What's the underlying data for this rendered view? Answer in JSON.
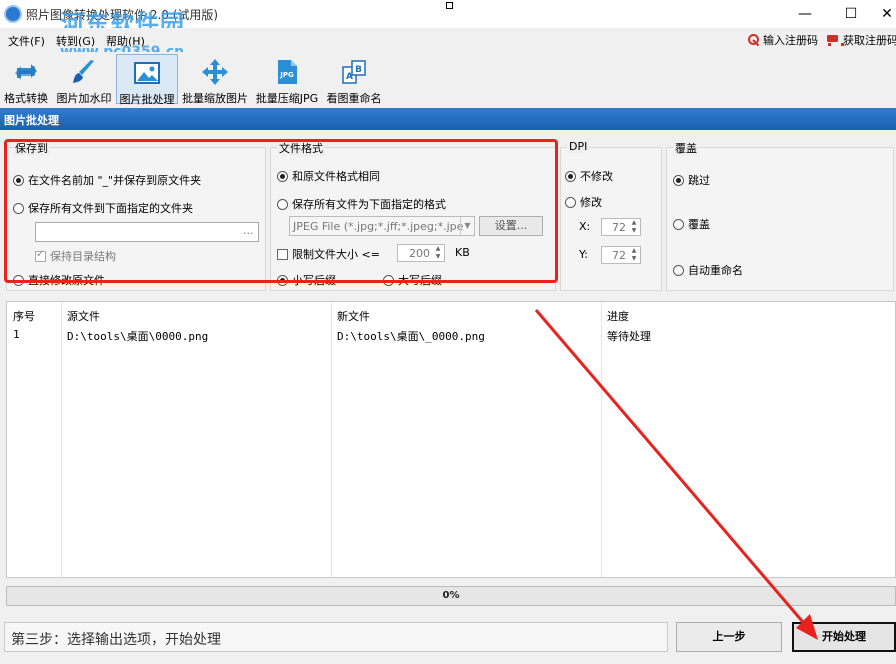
{
  "window": {
    "title": "照片图像转换处理软件 2.0 (试用版)",
    "watermark": "河东软件园",
    "watermark_url": "www.pc0359.cn",
    "minimize": "—",
    "maximize": "☐",
    "close": "✕"
  },
  "menu": {
    "items": [
      "文件(F)",
      "转到(G)",
      "帮助(H)"
    ],
    "register": "输入注册码",
    "get_code": "获取注册码"
  },
  "toolbar": {
    "tools": [
      {
        "label": "格式转换",
        "icon": "convert-icon"
      },
      {
        "label": "图片加水印",
        "icon": "brush-icon"
      },
      {
        "label": "图片批处理",
        "icon": "image-icon",
        "active": true
      },
      {
        "label": "批量缩放图片",
        "icon": "move-arrows-icon"
      },
      {
        "label": "批量压缩JPG",
        "icon": "jpg-file-icon"
      },
      {
        "label": "看图重命名",
        "icon": "rename-icon"
      }
    ]
  },
  "section": {
    "title": "图片批处理"
  },
  "save_to": {
    "title": "保存到",
    "opt_prefix": "在文件名前加 \"_\"并保存到原文件夹",
    "opt_folder": "保存所有文件到下面指定的文件夹",
    "folder_path": "",
    "browse": "...",
    "keep_structure": "保持目录结构",
    "overwrite": "直接修改原文件"
  },
  "file_format": {
    "title": "文件格式",
    "opt_same": "和原文件格式相同",
    "opt_convert": "保存所有文件为下面指定的格式",
    "format_value": "JPEG File (*.jpg;*.jff;*.jpeg;*.jpe",
    "settings": "设置...",
    "limit_size": "限制文件大小 <=",
    "size_value": "200",
    "size_unit": "KB",
    "lowercase_ext": "小写后缀",
    "uppercase_ext": "大写后缀"
  },
  "dpi": {
    "title": "DPI",
    "no_change": "不修改",
    "modify": "修改",
    "x_label": "X:",
    "x_value": "72",
    "y_label": "Y:",
    "y_value": "72"
  },
  "overwrite": {
    "title": "覆盖",
    "skip": "跳过",
    "overwrite": "覆盖",
    "auto_rename": "自动重命名"
  },
  "table": {
    "columns": [
      "序号",
      "源文件",
      "新文件",
      "进度"
    ],
    "rows": [
      {
        "index": "1",
        "source": "D:\\tools\\桌面\\0000.png",
        "target": "D:\\tools\\桌面\\_0000.png",
        "progress": "等待处理"
      }
    ]
  },
  "progress": {
    "text": "0%",
    "fraction": 0
  },
  "footer": {
    "status": "第三步：选择输出选项，开始处理",
    "prev": "上一步",
    "start": "开始处理"
  },
  "colors": {
    "accent": "#1c5fae",
    "annotation": "#e8231d"
  }
}
